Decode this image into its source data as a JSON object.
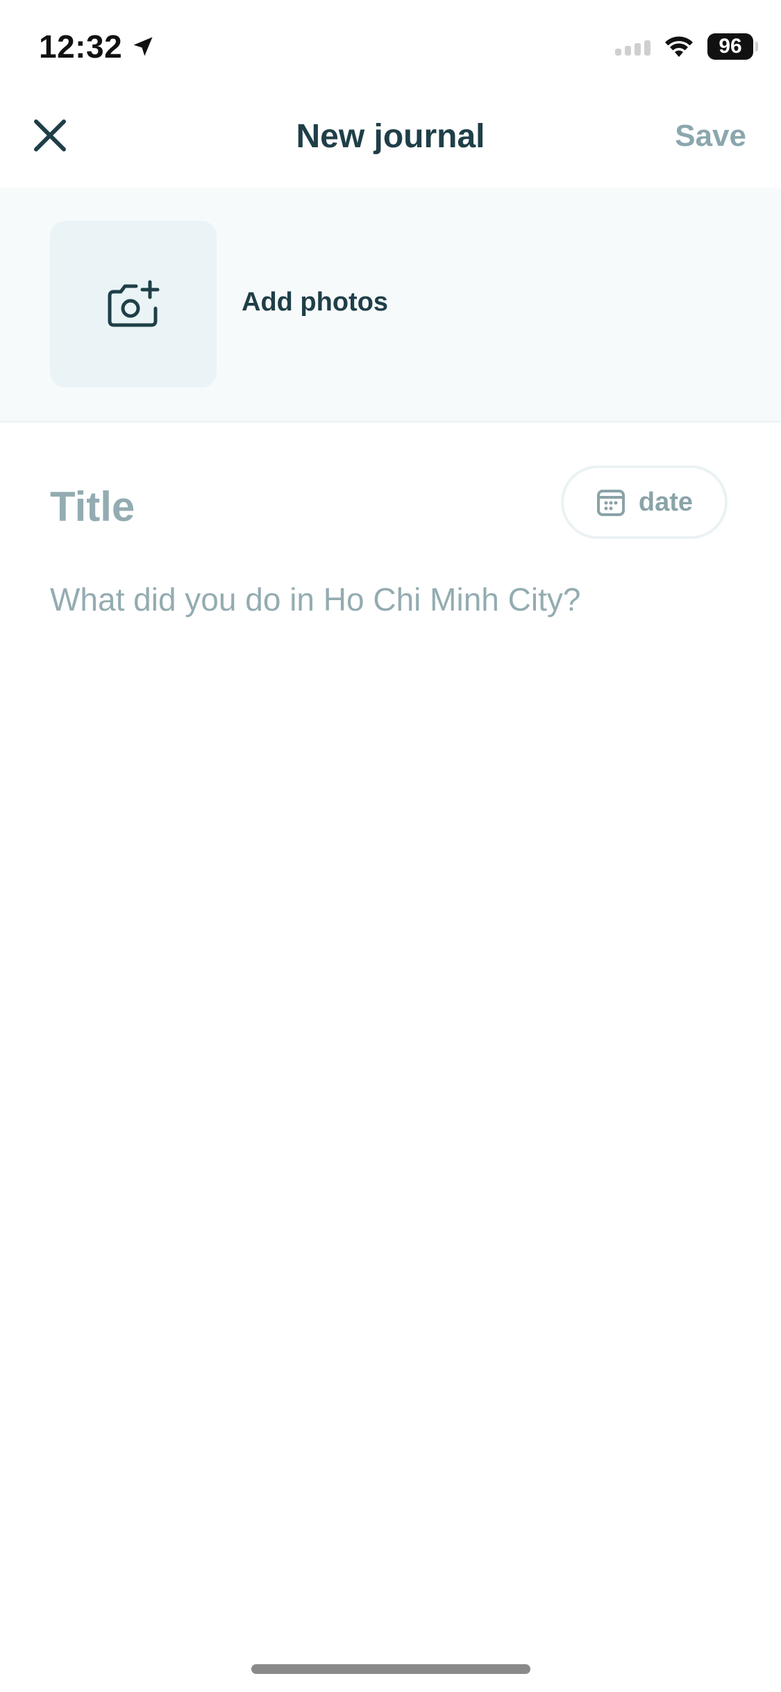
{
  "status_bar": {
    "time": "12:32",
    "battery": "96",
    "icons": [
      "location-arrow-icon",
      "signal-icon",
      "wifi-icon",
      "battery-icon"
    ]
  },
  "nav": {
    "title": "New journal",
    "save_label": "Save",
    "close_icon": "close-icon"
  },
  "photos": {
    "add_label": "Add photos",
    "icon": "camera-plus-icon"
  },
  "editor": {
    "title_placeholder": "Title",
    "date_label": "date",
    "date_icon": "calendar-icon",
    "body_placeholder": "What did you do in Ho Chi Minh City?"
  },
  "colors": {
    "primary_text": "#1f3f48",
    "muted_text": "#93acb1",
    "photo_section_bg": "#f7fafb",
    "photo_tile_bg": "#eaf4f6"
  }
}
